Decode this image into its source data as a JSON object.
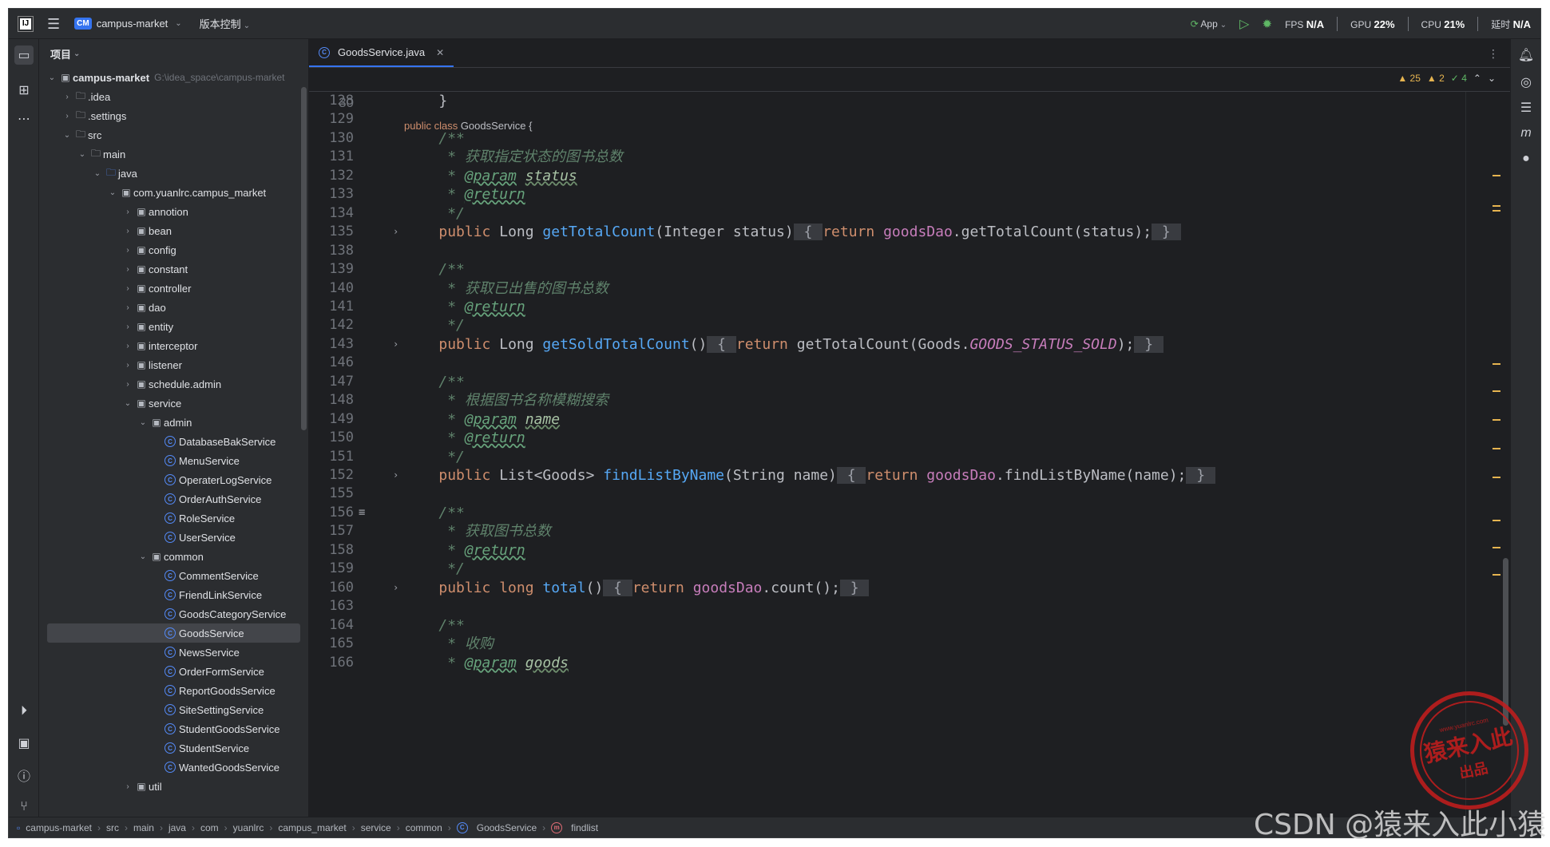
{
  "titlebar": {
    "logo": "IJ",
    "project_badge": "CM",
    "project_name": "campus-market",
    "vcs_label": "版本控制",
    "run_config": "App",
    "fps_label": "FPS",
    "fps_value": "N/A",
    "gpu_label": "GPU",
    "gpu_value": "22%",
    "cpu_label": "CPU",
    "cpu_value": "21%",
    "latency_label": "延时",
    "latency_value": "N/A"
  },
  "project_panel": {
    "title": "项目",
    "root_name": "campus-market",
    "root_path": "G:\\idea_space\\campus-market",
    "tree": [
      {
        "indent": 0,
        "arrow": "⌄",
        "icon": "module",
        "label": "campus-market",
        "bold": true,
        "path": true
      },
      {
        "indent": 1,
        "arrow": "›",
        "icon": "folder",
        "label": ".idea"
      },
      {
        "indent": 1,
        "arrow": "›",
        "icon": "folder",
        "label": ".settings"
      },
      {
        "indent": 1,
        "arrow": "⌄",
        "icon": "folder",
        "label": "src"
      },
      {
        "indent": 2,
        "arrow": "⌄",
        "icon": "folder",
        "label": "main"
      },
      {
        "indent": 3,
        "arrow": "⌄",
        "icon": "folder-src",
        "label": "java"
      },
      {
        "indent": 4,
        "arrow": "⌄",
        "icon": "package",
        "label": "com.yuanlrc.campus_market"
      },
      {
        "indent": 5,
        "arrow": "›",
        "icon": "package",
        "label": "annotion"
      },
      {
        "indent": 5,
        "arrow": "›",
        "icon": "package",
        "label": "bean"
      },
      {
        "indent": 5,
        "arrow": "›",
        "icon": "package",
        "label": "config"
      },
      {
        "indent": 5,
        "arrow": "›",
        "icon": "package",
        "label": "constant"
      },
      {
        "indent": 5,
        "arrow": "›",
        "icon": "package",
        "label": "controller"
      },
      {
        "indent": 5,
        "arrow": "›",
        "icon": "package",
        "label": "dao"
      },
      {
        "indent": 5,
        "arrow": "›",
        "icon": "package",
        "label": "entity"
      },
      {
        "indent": 5,
        "arrow": "›",
        "icon": "package",
        "label": "interceptor"
      },
      {
        "indent": 5,
        "arrow": "›",
        "icon": "package",
        "label": "listener"
      },
      {
        "indent": 5,
        "arrow": "›",
        "icon": "package",
        "label": "schedule.admin"
      },
      {
        "indent": 5,
        "arrow": "⌄",
        "icon": "package",
        "label": "service"
      },
      {
        "indent": 6,
        "arrow": "⌄",
        "icon": "package",
        "label": "admin"
      },
      {
        "indent": 7,
        "arrow": "",
        "icon": "class",
        "label": "DatabaseBakService"
      },
      {
        "indent": 7,
        "arrow": "",
        "icon": "class",
        "label": "MenuService"
      },
      {
        "indent": 7,
        "arrow": "",
        "icon": "class",
        "label": "OperaterLogService"
      },
      {
        "indent": 7,
        "arrow": "",
        "icon": "class",
        "label": "OrderAuthService"
      },
      {
        "indent": 7,
        "arrow": "",
        "icon": "class",
        "label": "RoleService"
      },
      {
        "indent": 7,
        "arrow": "",
        "icon": "class",
        "label": "UserService"
      },
      {
        "indent": 6,
        "arrow": "⌄",
        "icon": "package",
        "label": "common"
      },
      {
        "indent": 7,
        "arrow": "",
        "icon": "class",
        "label": "CommentService"
      },
      {
        "indent": 7,
        "arrow": "",
        "icon": "class",
        "label": "FriendLinkService"
      },
      {
        "indent": 7,
        "arrow": "",
        "icon": "class",
        "label": "GoodsCategoryService"
      },
      {
        "indent": 7,
        "arrow": "",
        "icon": "class",
        "label": "GoodsService",
        "selected": true
      },
      {
        "indent": 7,
        "arrow": "",
        "icon": "class",
        "label": "NewsService"
      },
      {
        "indent": 7,
        "arrow": "",
        "icon": "class",
        "label": "OrderFormService"
      },
      {
        "indent": 7,
        "arrow": "",
        "icon": "class",
        "label": "ReportGoodsService"
      },
      {
        "indent": 7,
        "arrow": "",
        "icon": "class",
        "label": "SiteSettingService"
      },
      {
        "indent": 7,
        "arrow": "",
        "icon": "class",
        "label": "StudentGoodsService"
      },
      {
        "indent": 7,
        "arrow": "",
        "icon": "class",
        "label": "StudentService"
      },
      {
        "indent": 7,
        "arrow": "",
        "icon": "class",
        "label": "WantedGoodsService"
      },
      {
        "indent": 5,
        "arrow": "›",
        "icon": "package",
        "label": "util"
      }
    ]
  },
  "editor": {
    "tab_label": "GoodsService.java",
    "inspections": {
      "warnings": "25",
      "weak_warnings": "2",
      "ok": "4"
    },
    "sticky_line": {
      "num": "30",
      "html": "<span class='kw'>public class</span> GoodsService {"
    },
    "lines": [
      {
        "num": "128",
        "html": "    }"
      },
      {
        "num": "129",
        "html": ""
      },
      {
        "num": "130",
        "html": "    <span class='cm'>/**</span>"
      },
      {
        "num": "131",
        "html": "     <span class='cm'>* </span><span class='cmcn'>获取指定状态的图书总数</span>"
      },
      {
        "num": "132",
        "html": "     <span class='cm'>* </span><span class='tag'>@param</span> <span class='par'>status</span>"
      },
      {
        "num": "133",
        "html": "     <span class='cm'>* </span><span class='tag'>@return</span>"
      },
      {
        "num": "134",
        "html": "     <span class='cm'>*/</span>"
      },
      {
        "num": "135",
        "fold": true,
        "html": "    <span class='kw'>public</span> Long <span class='fn'>getTotalCount</span>(Integer status)<span class='brace'> { </span><span class='kw'>return</span> <span class='fld'>goodsDao</span>.getTotalCount(status);<span class='brace'> } </span>"
      },
      {
        "num": "138",
        "html": ""
      },
      {
        "num": "139",
        "html": "    <span class='cm'>/**</span>"
      },
      {
        "num": "140",
        "html": "     <span class='cm'>* </span><span class='cmcn'>获取已出售的图书总数</span>"
      },
      {
        "num": "141",
        "html": "     <span class='cm'>* </span><span class='tag'>@return</span>"
      },
      {
        "num": "142",
        "html": "     <span class='cm'>*/</span>"
      },
      {
        "num": "143",
        "fold": true,
        "html": "    <span class='kw'>public</span> Long <span class='fn'>getSoldTotalCount</span>()<span class='brace'> { </span><span class='kw'>return</span> getTotalCount(Goods.<span class='cst'>GOODS_STATUS_SOLD</span>);<span class='brace'> } </span>"
      },
      {
        "num": "146",
        "html": ""
      },
      {
        "num": "147",
        "html": "    <span class='cm'>/**</span>"
      },
      {
        "num": "148",
        "html": "     <span class='cm'>* </span><span class='cmcn'>根据图书名称模糊搜索</span>"
      },
      {
        "num": "149",
        "html": "     <span class='cm'>* </span><span class='tag'>@param</span> <span class='par'>name</span>"
      },
      {
        "num": "150",
        "html": "     <span class='cm'>* </span><span class='tag'>@return</span>"
      },
      {
        "num": "151",
        "html": "     <span class='cm'>*/</span>"
      },
      {
        "num": "152",
        "fold": true,
        "html": "    <span class='kw'>public</span> List&lt;Goods&gt; <span class='fn'>findListByName</span>(String name)<span class='brace'> { </span><span class='kw'>return</span> <span class='fld'>goodsDao</span>.findListByName(name);<span class='brace'> } </span>"
      },
      {
        "num": "155",
        "html": ""
      },
      {
        "num": "156",
        "html": "    <span class='cm'>/**</span>",
        "icon": true
      },
      {
        "num": "157",
        "html": "     <span class='cm'>* </span><span class='cmcn'>获取图书总数</span>"
      },
      {
        "num": "158",
        "html": "     <span class='cm'>* </span><span class='tag'>@return</span>"
      },
      {
        "num": "159",
        "html": "     <span class='cm'>*/</span>"
      },
      {
        "num": "160",
        "fold": true,
        "html": "    <span class='kw'>public long</span> <span class='fn'>total</span>()<span class='brace'> { </span><span class='kw'>return</span> <span class='fld'>goodsDao</span>.count();<span class='brace'> } </span>"
      },
      {
        "num": "163",
        "html": ""
      },
      {
        "num": "164",
        "html": "    <span class='cm'>/**</span>"
      },
      {
        "num": "165",
        "html": "     <span class='cm'>* </span><span class='cmcn'>收购</span>"
      },
      {
        "num": "166",
        "html": "     <span class='cm'>* </span><span class='tag'>@param</span> <span class='par'>goods</span>"
      }
    ]
  },
  "statusbar": {
    "crumbs": [
      "campus-market",
      "src",
      "main",
      "java",
      "com",
      "yuanlrc",
      "campus_market",
      "service",
      "common",
      "GoodsService",
      "findlist"
    ]
  },
  "watermark": {
    "stamp_url": "www.yuanlrc.com",
    "stamp_main": "猿来入此",
    "stamp_sub": "出品",
    "csdn": "CSDN @猿来入此小猿"
  },
  "colors": {
    "background": "#1e1f22",
    "panel": "#2b2d30",
    "keyword": "#cf8e6d",
    "function": "#56a8f5",
    "field": "#c77dbb",
    "comment": "#5f826b",
    "accent": "#3574f0",
    "stamp": "#c61d1d"
  }
}
